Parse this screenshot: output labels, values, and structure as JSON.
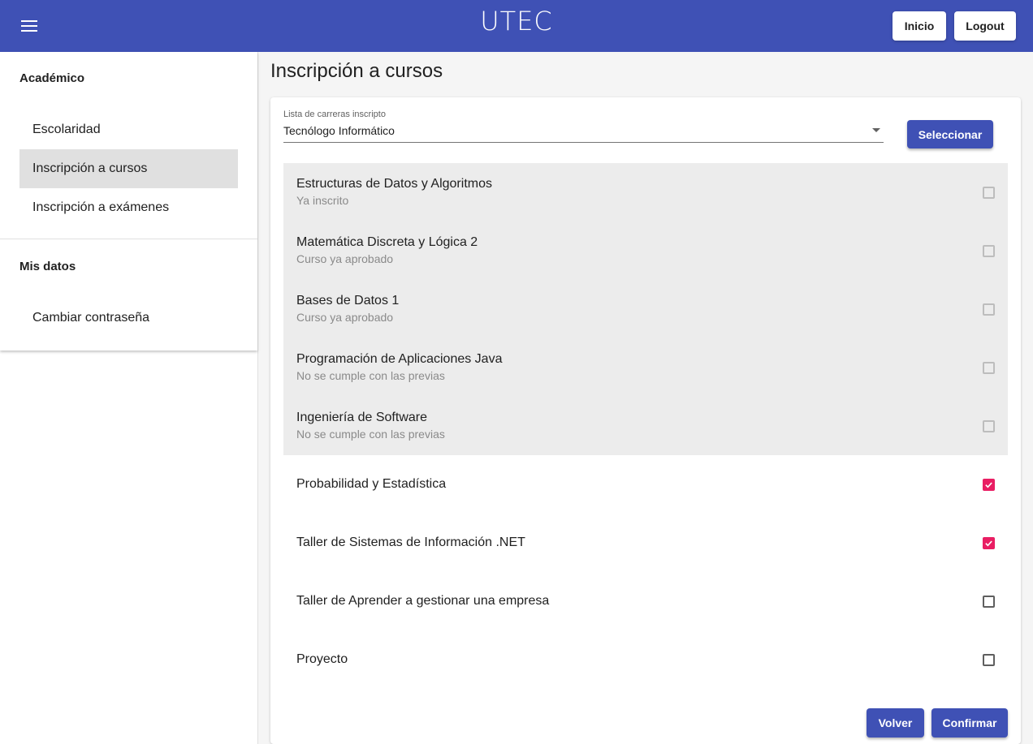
{
  "header": {
    "logo_text": "UTEC",
    "inicio_label": "Inicio",
    "logout_label": "Logout"
  },
  "sidebar": {
    "sections": [
      {
        "title": "Académico",
        "items": [
          {
            "label": "Escolaridad",
            "active": false
          },
          {
            "label": "Inscripción a cursos",
            "active": true
          },
          {
            "label": "Inscripción a exámenes",
            "active": false
          }
        ]
      },
      {
        "title": "Mis datos",
        "items": [
          {
            "label": "Cambiar contraseña",
            "active": false
          }
        ]
      }
    ]
  },
  "main": {
    "title": "Inscripción a cursos",
    "select": {
      "label": "Lista de carreras inscripto",
      "value": "Tecnólogo Informático"
    },
    "select_button": "Seleccionar",
    "courses": [
      {
        "name": "Estructuras de Datos y Algoritmos",
        "status": "Ya inscrito",
        "disabled": true,
        "checked": false
      },
      {
        "name": "Matemática Discreta y Lógica 2",
        "status": "Curso ya aprobado",
        "disabled": true,
        "checked": false
      },
      {
        "name": "Bases de Datos 1",
        "status": "Curso ya aprobado",
        "disabled": true,
        "checked": false
      },
      {
        "name": "Programación de Aplicaciones Java",
        "status": "No se cumple con las previas",
        "disabled": true,
        "checked": false
      },
      {
        "name": "Ingeniería de Software",
        "status": "No se cumple con las previas",
        "disabled": true,
        "checked": false
      },
      {
        "name": "Probabilidad y Estadística",
        "status": "",
        "disabled": false,
        "checked": true
      },
      {
        "name": "Taller de Sistemas de Información .NET",
        "status": "",
        "disabled": false,
        "checked": true
      },
      {
        "name": "Taller de Aprender a gestionar una empresa",
        "status": "",
        "disabled": false,
        "checked": false
      },
      {
        "name": "Proyecto",
        "status": "",
        "disabled": false,
        "checked": false
      }
    ],
    "back_button": "Volver",
    "confirm_button": "Confirmar"
  },
  "colors": {
    "primary": "#3f51b5",
    "accent": "#e91e63",
    "disabled_row": "#ececec"
  }
}
